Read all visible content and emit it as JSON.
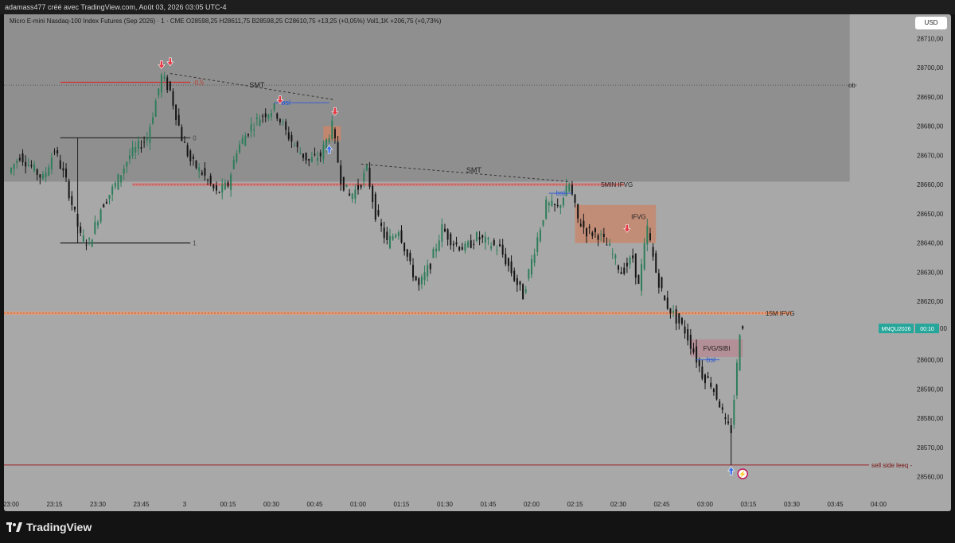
{
  "header": {
    "credit": "adamass477 créé avec TradingView.com, Août 03, 2026 03:05 UTC-4"
  },
  "legend": {
    "text": "Micro E-mini Nasdaq-100 Index Futures (Sep 2026) · 1 · CME  O28598,25  H28611,75  B28598,25  C28610,75  +13,25 (+0,05%)  Vol1,1K  +206,75 (+0,73%)"
  },
  "currency": "USD",
  "footer": {
    "brand": "TradingView"
  },
  "chart_data": {
    "type": "candlestick",
    "ylim": [
      28555,
      28715
    ],
    "xlim_minutes": [
      0,
      300
    ],
    "y_ticks": [
      {
        "value": 28560,
        "label": "28560,00"
      },
      {
        "value": 28570,
        "label": "28570,00"
      },
      {
        "value": 28580,
        "label": "28580,00"
      },
      {
        "value": 28590,
        "label": "28590,00"
      },
      {
        "value": 28600,
        "label": "28600,00"
      },
      {
        "value": 28620,
        "label": "28620,00"
      },
      {
        "value": 28630,
        "label": "28630,00"
      },
      {
        "value": 28640,
        "label": "28640,00"
      },
      {
        "value": 28650,
        "label": "28650,00"
      },
      {
        "value": 28660,
        "label": "28660,00"
      },
      {
        "value": 28670,
        "label": "28670,00"
      },
      {
        "value": 28680,
        "label": "28680,00"
      },
      {
        "value": 28690,
        "label": "28690,00"
      },
      {
        "value": 28700,
        "label": "28700,00"
      },
      {
        "value": 28710,
        "label": "28710,00"
      }
    ],
    "x_ticks": [
      {
        "t": 0,
        "label": "23:00"
      },
      {
        "t": 15,
        "label": "23:15"
      },
      {
        "t": 30,
        "label": "23:30"
      },
      {
        "t": 45,
        "label": "23:45"
      },
      {
        "t": 60,
        "label": "3"
      },
      {
        "t": 75,
        "label": "00:15"
      },
      {
        "t": 90,
        "label": "00:30"
      },
      {
        "t": 105,
        "label": "00:45"
      },
      {
        "t": 120,
        "label": "01:00"
      },
      {
        "t": 135,
        "label": "01:15"
      },
      {
        "t": 150,
        "label": "01:30"
      },
      {
        "t": 165,
        "label": "01:45"
      },
      {
        "t": 180,
        "label": "02:00"
      },
      {
        "t": 195,
        "label": "02:15"
      },
      {
        "t": 210,
        "label": "02:30"
      },
      {
        "t": 225,
        "label": "02:45"
      },
      {
        "t": 240,
        "label": "03:00"
      },
      {
        "t": 255,
        "label": "03:15"
      },
      {
        "t": 270,
        "label": "03:30"
      },
      {
        "t": 285,
        "label": "03:45"
      },
      {
        "t": 300,
        "label": "04:00"
      }
    ],
    "path_key_points": [
      [
        0,
        28664
      ],
      [
        4,
        28670
      ],
      [
        8,
        28666
      ],
      [
        12,
        28662
      ],
      [
        16,
        28672
      ],
      [
        20,
        28661
      ],
      [
        25,
        28642
      ],
      [
        28,
        28640
      ],
      [
        32,
        28652
      ],
      [
        37,
        28660
      ],
      [
        42,
        28670
      ],
      [
        48,
        28676
      ],
      [
        53,
        28697
      ],
      [
        56,
        28692
      ],
      [
        60,
        28676
      ],
      [
        63,
        28668
      ],
      [
        67,
        28664
      ],
      [
        72,
        28657
      ],
      [
        76,
        28660
      ],
      [
        79,
        28672
      ],
      [
        84,
        28680
      ],
      [
        88,
        28684
      ],
      [
        92,
        28686
      ],
      [
        96,
        28678
      ],
      [
        100,
        28672
      ],
      [
        104,
        28668
      ],
      [
        108,
        28670
      ],
      [
        112,
        28680
      ],
      [
        115,
        28662
      ],
      [
        118,
        28656
      ],
      [
        121,
        28659
      ],
      [
        124,
        28665
      ],
      [
        127,
        28650
      ],
      [
        131,
        28640
      ],
      [
        135,
        28645
      ],
      [
        139,
        28632
      ],
      [
        142,
        28625
      ],
      [
        146,
        28633
      ],
      [
        150,
        28645
      ],
      [
        154,
        28640
      ],
      [
        158,
        28638
      ],
      [
        162,
        28642
      ],
      [
        166,
        28640
      ],
      [
        170,
        28638
      ],
      [
        174,
        28630
      ],
      [
        178,
        28622
      ],
      [
        182,
        28638
      ],
      [
        186,
        28653
      ],
      [
        190,
        28652
      ],
      [
        194,
        28660
      ],
      [
        197,
        28648
      ],
      [
        200,
        28644
      ],
      [
        204,
        28643
      ],
      [
        208,
        28638
      ],
      [
        212,
        28630
      ],
      [
        216,
        28635
      ],
      [
        218,
        28625
      ],
      [
        221,
        28645
      ],
      [
        224,
        28630
      ],
      [
        227,
        28620
      ],
      [
        231,
        28614
      ],
      [
        234,
        28610
      ],
      [
        237,
        28603
      ],
      [
        240,
        28595
      ],
      [
        243,
        28592
      ],
      [
        246,
        28585
      ],
      [
        248,
        28578
      ],
      [
        250,
        28576
      ],
      [
        252,
        28598
      ],
      [
        253,
        28610
      ]
    ],
    "levels": [
      {
        "name": "ob",
        "value": 28694
      },
      {
        "name": "5MIN IFVG",
        "value": 28660
      },
      {
        "name": "15M IFVG",
        "value": 28616
      },
      {
        "name": "sell side leeq -",
        "value": 28564
      }
    ],
    "fib_labels": [
      {
        "label": "-0,5",
        "value": 28695
      },
      {
        "label": "0",
        "value": 28676
      },
      {
        "label": "1",
        "value": 28640
      }
    ],
    "zones": [
      {
        "label": "IFVG",
        "t0": 195,
        "t1": 223,
        "y0": 28653,
        "y1": 28640
      },
      {
        "label": "FVG/SIBI",
        "t0": 235,
        "t1": 253,
        "y0": 28607,
        "y1": 28601
      }
    ],
    "annotations": [
      {
        "label": "SMT",
        "t": 85,
        "value": 28694
      },
      {
        "label": "SMT",
        "t": 160,
        "value": 28665
      },
      {
        "label": "bsl",
        "t": 95,
        "value": 28688
      },
      {
        "label": "bsl",
        "t": 190,
        "value": 28657
      },
      {
        "label": "bsl",
        "t": 242,
        "value": 28600
      }
    ],
    "last_price": {
      "symbol": "MNQU2026",
      "countdown": "00:10",
      "value": 28610.75
    }
  }
}
